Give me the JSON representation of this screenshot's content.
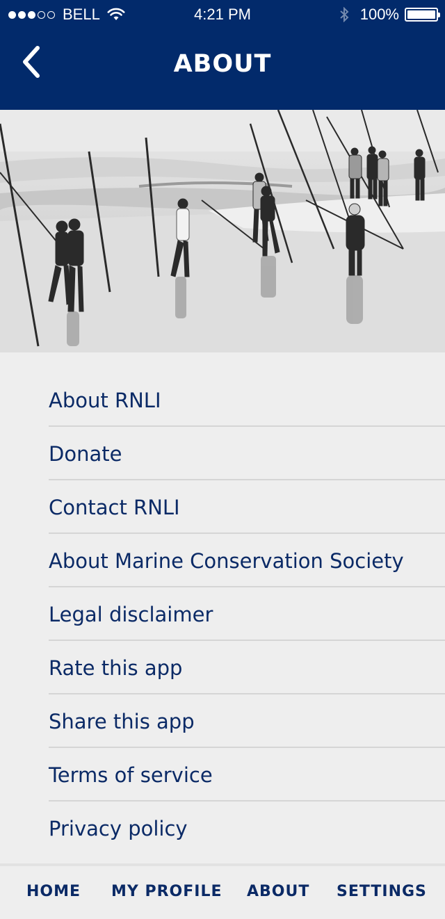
{
  "status_bar": {
    "carrier": "BELL",
    "time": "4:21 PM",
    "battery": "100%",
    "signal_bars_filled": 3,
    "signal_bars_total": 5
  },
  "header": {
    "title": "ABOUT",
    "background_color": "#022a6b"
  },
  "menu": {
    "items": [
      {
        "label": "About RNLI"
      },
      {
        "label": "Donate"
      },
      {
        "label": "Contact RNLI"
      },
      {
        "label": "About Marine Conservation Society"
      },
      {
        "label": "Legal disclaimer"
      },
      {
        "label": "Rate this app"
      },
      {
        "label": "Share this app"
      },
      {
        "label": "Terms of service"
      },
      {
        "label": "Privacy policy"
      }
    ],
    "text_color": "#0b2a66"
  },
  "tabbar": {
    "tabs": [
      {
        "label": "HOME"
      },
      {
        "label": "MY PROFILE"
      },
      {
        "label": "ABOUT"
      },
      {
        "label": "SETTINGS"
      }
    ]
  }
}
